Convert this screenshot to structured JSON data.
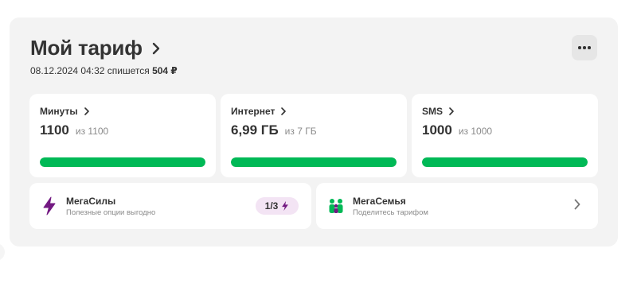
{
  "colors": {
    "accent_green": "#00b956",
    "accent_purple": "#731982",
    "card_bg": "#f3f3f3"
  },
  "header": {
    "title": "Мой тариф",
    "date": "08.12.2024 04:32",
    "charge_text": "спишется",
    "charge_amount": "504 ₽",
    "more_icon": "more-horizontal-icon"
  },
  "tiles": [
    {
      "label": "Минуты",
      "value": "1100",
      "of_text": "из 1100",
      "progress": 1.0
    },
    {
      "label": "Интернет",
      "value": "6,99 ГБ",
      "of_text": "из 7 ГБ",
      "progress": 0.9986
    },
    {
      "label": "SMS",
      "value": "1000",
      "of_text": "из 1000",
      "progress": 1.0
    }
  ],
  "megasily": {
    "title": "МегаСилы",
    "subtitle": "Полезные опции выгодно",
    "badge": "1/3",
    "icon": "lightning-icon"
  },
  "megasemya": {
    "title": "МегаСемья",
    "subtitle": "Поделитесь тарифом",
    "icon": "family-icon"
  }
}
